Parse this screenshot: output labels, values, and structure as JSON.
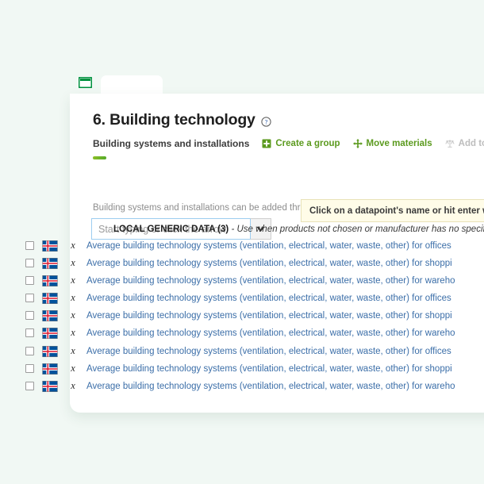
{
  "theme": {
    "page_background": "#f1f8f4",
    "card_background": "#ffffff",
    "accent_green": "#5b9a1e",
    "link_blue": "#3b6ea8",
    "disabled_grey": "#bdbdbd",
    "banner_yellow": "#fffce8"
  },
  "window": {
    "logo_icon": "app-window-icon",
    "tab_label": ""
  },
  "header": {
    "title": "6. Building technology",
    "help_icon": "help-circle-icon",
    "subtitle": "Building systems and installations",
    "actions": [
      {
        "label": "Create a group",
        "icon": "plus-square-icon",
        "disabled": false
      },
      {
        "label": "Move materials",
        "icon": "move-arrows-icon",
        "disabled": false
      },
      {
        "label": "Add to compare",
        "icon": "balance-scales-icon",
        "disabled": true
      }
    ]
  },
  "helper_text": "Building systems and installations can be added through this section only.",
  "search": {
    "placeholder": "Start typing or click the arrow",
    "value": "",
    "dropdown_icon": "chevron-down-icon"
  },
  "hint_banner": {
    "text": "Click on a datapoint's name or hit enter when"
  },
  "group": {
    "label": "LOCAL GENERIC DATA (3)",
    "note": "- Use when products not chosen or manufacturer has no specific da"
  },
  "datapoints": [
    {
      "flag": "iceland-flag-icon",
      "type_icon": "average-x-bar-icon",
      "label": "Average building technology systems (ventilation, electrical, water, waste, other) for offices",
      "group_break": false
    },
    {
      "flag": "iceland-flag-icon",
      "type_icon": "average-x-bar-icon",
      "label": "Average building technology systems (ventilation, electrical, water, waste, other) for shoppi",
      "group_break": false
    },
    {
      "flag": "iceland-flag-icon",
      "type_icon": "average-x-bar-icon",
      "label": "Average building technology systems (ventilation, electrical, water, waste, other) for wareho",
      "group_break": false
    },
    {
      "flag": "iceland-flag-icon",
      "type_icon": "average-x-bar-icon",
      "label": "Average building technology systems (ventilation, electrical, water, waste, other) for offices",
      "group_break": false
    },
    {
      "flag": "iceland-flag-icon",
      "type_icon": "average-x-bar-icon",
      "label": "Average building technology systems (ventilation, electrical, water, waste, other) for shoppi",
      "group_break": false
    },
    {
      "flag": "iceland-flag-icon",
      "type_icon": "average-x-bar-icon",
      "label": "Average building technology systems (ventilation, electrical, water, waste, other) for wareho",
      "group_break": false
    },
    {
      "flag": "iceland-flag-icon",
      "type_icon": "average-x-bar-icon",
      "label": "Average building technology systems (ventilation, electrical, water, waste, other) for offices",
      "group_break": true
    },
    {
      "flag": "iceland-flag-icon",
      "type_icon": "average-x-bar-icon",
      "label": "Average building technology systems (ventilation, electrical, water, waste, other) for shoppi",
      "group_break": false
    },
    {
      "flag": "iceland-flag-icon",
      "type_icon": "average-x-bar-icon",
      "label": "Average building technology systems (ventilation, electrical, water, waste, other) for wareho",
      "group_break": false
    }
  ]
}
